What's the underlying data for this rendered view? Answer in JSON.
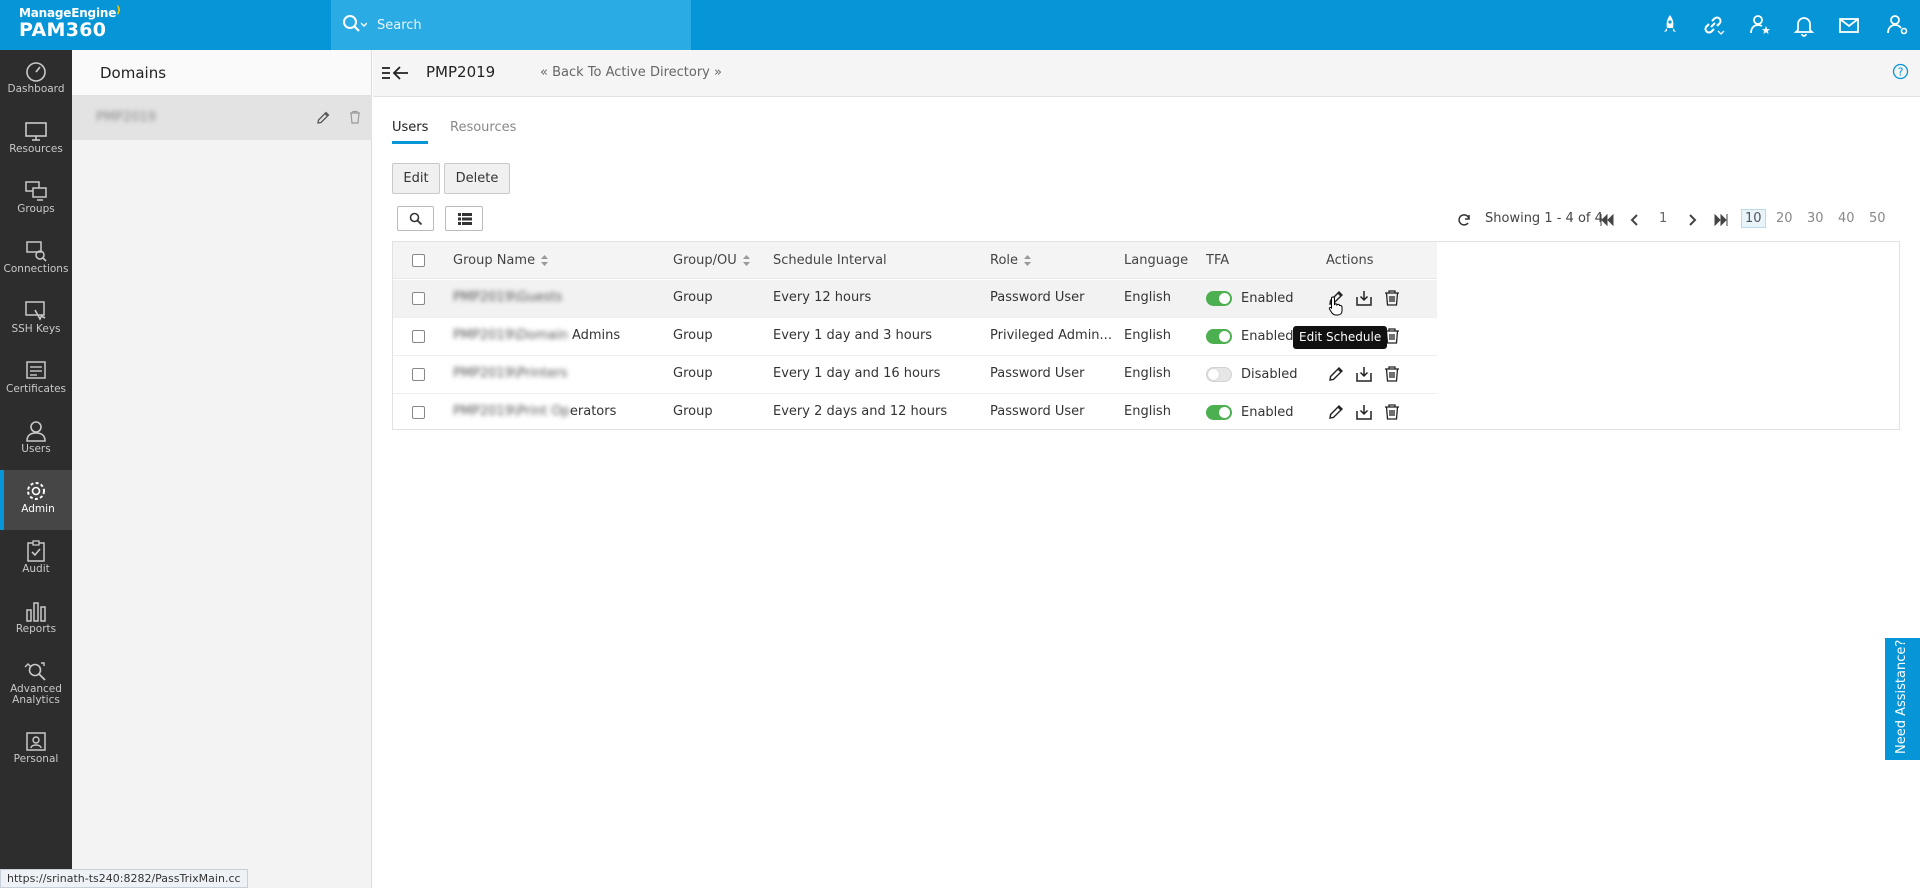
{
  "brand": {
    "company": "ManageEngine",
    "product": "PAM360"
  },
  "search": {
    "placeholder": "Search"
  },
  "topbar_icons": [
    "rocket-icon",
    "link-icon",
    "user-star-icon",
    "bell-icon",
    "mail-icon",
    "user-settings-icon"
  ],
  "nav": [
    {
      "label": "Dashboard",
      "icon": "dashboard-icon"
    },
    {
      "label": "Resources",
      "icon": "monitor-icon"
    },
    {
      "label": "Groups",
      "icon": "groups-icon"
    },
    {
      "label": "Connections",
      "icon": "connections-icon"
    },
    {
      "label": "SSH Keys",
      "icon": "ssh-keys-icon"
    },
    {
      "label": "Certificates",
      "icon": "certificate-icon"
    },
    {
      "label": "Users",
      "icon": "user-icon"
    },
    {
      "label": "Admin",
      "icon": "gear-icon",
      "active": true
    },
    {
      "label": "Audit",
      "icon": "clipboard-icon"
    },
    {
      "label": "Reports",
      "icon": "bar-chart-icon"
    },
    {
      "label": "Advanced Analytics",
      "icon": "analytics-icon"
    },
    {
      "label": "Personal",
      "icon": "personal-icon"
    }
  ],
  "domains": {
    "title": "Domains",
    "item": "PMP2019"
  },
  "header": {
    "title": "PMP2019",
    "back_link": "« Back To Active Directory »"
  },
  "tabs": [
    "Users",
    "Resources"
  ],
  "toolbar": {
    "edit": "Edit",
    "delete": "Delete"
  },
  "paging": {
    "showing": "Showing 1 - 4 of 4",
    "page": "1",
    "sizes": [
      "10",
      "20",
      "30",
      "40",
      "50"
    ],
    "selected_size": "10"
  },
  "table": {
    "columns": [
      "Group Name",
      "Group/OU",
      "Schedule Interval",
      "Role",
      "Language",
      "TFA",
      "Actions"
    ],
    "rows": [
      {
        "name_blur": "PMP2019\\Guests",
        "name_tail": "",
        "type": "Group",
        "interval": "Every 12 hours",
        "role": "Password User",
        "language": "English",
        "tfa": "Enabled",
        "tfa_on": true
      },
      {
        "name_blur": "PMP2019\\Domain",
        "name_tail": "Admins",
        "type": "Group",
        "interval": "Every 1 day and 3 hours",
        "role": "Privileged Admin...",
        "language": "English",
        "tfa": "Enabled",
        "tfa_on": true
      },
      {
        "name_blur": "PMP2019\\Printers",
        "name_tail": "",
        "type": "Group",
        "interval": "Every 1 day and 16 hours",
        "role": "Password User",
        "language": "English",
        "tfa": "Disabled",
        "tfa_on": false
      },
      {
        "name_blur": "PMP2019\\Print Op",
        "name_tail": "erators",
        "type": "Group",
        "interval": "Every 2 days and 12 hours",
        "role": "Password User",
        "language": "English",
        "tfa": "Enabled",
        "tfa_on": true
      }
    ]
  },
  "tooltip": "Edit Schedule",
  "status_url": "https://srinath-ts240:8282/PassTrixMain.cc",
  "assist": "Need Assistance?",
  "colors": {
    "brand": "#0696d7",
    "nav_bg": "#2d2d2d",
    "toggle_on": "#4caf50"
  }
}
